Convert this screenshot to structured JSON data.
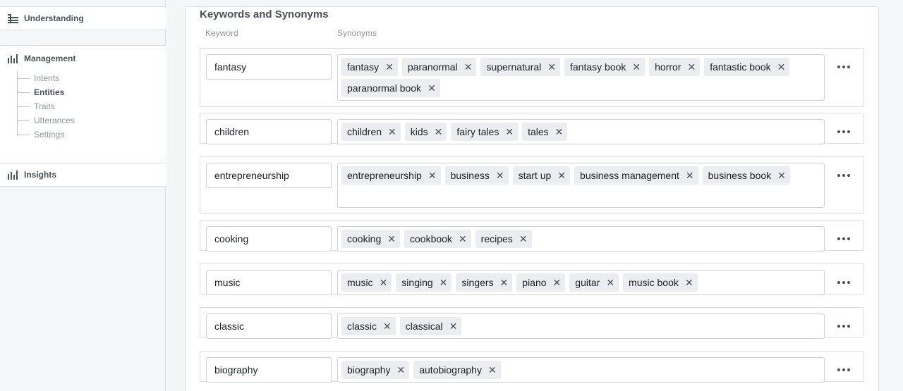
{
  "sidebar": {
    "understanding_label": "Understanding",
    "management_label": "Management",
    "management_items": [
      {
        "label": "Intents",
        "active": false
      },
      {
        "label": "Entities",
        "active": true
      },
      {
        "label": "Traits",
        "active": false
      },
      {
        "label": "Utterances",
        "active": false
      },
      {
        "label": "Settings",
        "active": false
      }
    ],
    "insights_label": "Insights"
  },
  "panel": {
    "title": "Keywords and Synonyms",
    "keyword_header": "Keyword",
    "synonyms_header": "Synonyms",
    "remove_glyph": "✕"
  },
  "rows": [
    {
      "keyword": "fantasy",
      "synonyms": [
        "fantasy",
        "paranormal",
        "supernatural",
        "fantasy book",
        "horror",
        "fantastic book",
        "paranormal book"
      ]
    },
    {
      "keyword": "children",
      "synonyms": [
        "children",
        "kids",
        "fairy tales",
        "tales"
      ]
    },
    {
      "keyword": "entrepreneurship",
      "synonyms": [
        "entrepreneurship",
        "business",
        "start up",
        "business management",
        "business book"
      ]
    },
    {
      "keyword": "cooking",
      "synonyms": [
        "cooking",
        "cookbook",
        "recipes"
      ]
    },
    {
      "keyword": "music",
      "synonyms": [
        "music",
        "singing",
        "singers",
        "piano",
        "guitar",
        "music book"
      ]
    },
    {
      "keyword": "classic",
      "synonyms": [
        "classic",
        "classical"
      ]
    },
    {
      "keyword": "biography",
      "synonyms": [
        "biography",
        "autobiography"
      ]
    }
  ]
}
